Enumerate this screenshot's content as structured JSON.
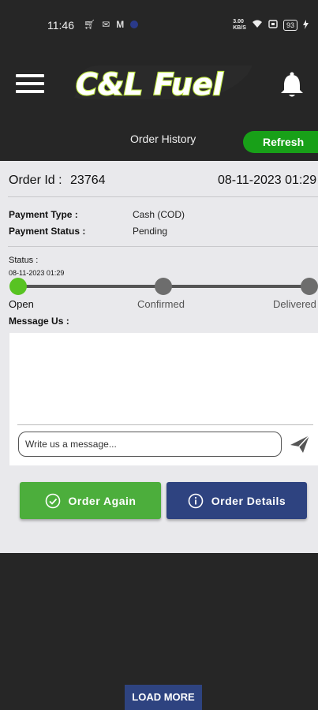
{
  "status_bar": {
    "time": "11:46",
    "network_speed": "3.00\nKB/S",
    "battery": "93"
  },
  "header": {
    "logo_text": "C&L Fuel"
  },
  "subheader": {
    "title": "Order History",
    "refresh_label": "Refresh"
  },
  "order": {
    "id_label": "Order Id :",
    "id_value": "23764",
    "datetime": "08-11-2023 01:29",
    "payment_type_label": "Payment Type :",
    "payment_type_value": "Cash (COD)",
    "payment_status_label": "Payment Status :",
    "payment_status_value": "Pending",
    "status_label": "Status :",
    "status_date": "08-11-2023 01:29",
    "steps": [
      {
        "label": "Open",
        "active": true
      },
      {
        "label": "Confirmed",
        "active": false
      },
      {
        "label": "Delivered",
        "active": false
      }
    ]
  },
  "message": {
    "label": "Message Us :",
    "placeholder": "Write us a message..."
  },
  "actions": {
    "order_again": "Order Again",
    "order_details": "Order Details"
  },
  "load_more": "LOAD MORE",
  "colors": {
    "background": "#262626",
    "accent_green": "#58c322",
    "button_green": "#4cae3c",
    "button_blue": "#2e4380",
    "refresh_green": "#18a018"
  }
}
